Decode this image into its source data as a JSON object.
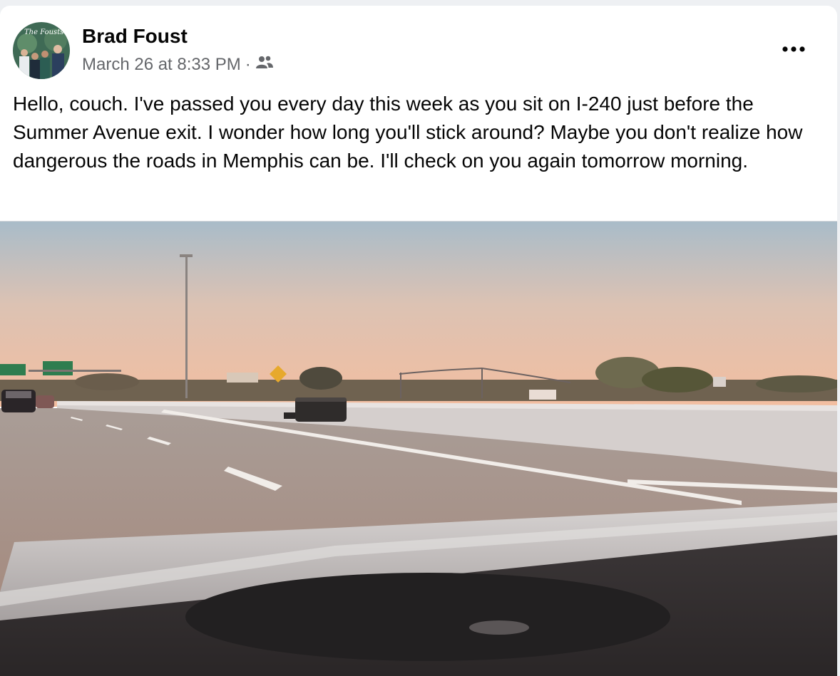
{
  "post": {
    "author": "Brad Foust",
    "timestamp": "March 26 at 8:33 PM",
    "separator": "·",
    "audience_icon": "friends-icon",
    "more_icon": "more-options-icon",
    "avatar_text": "The Fousts",
    "message": "Hello, couch. I've passed you every day this week as you sit on I-240 just before the Summer Avenue exit. I wonder how long you'll stick around? Maybe you don't realize how dangerous the roads in Memphis can be. I'll check on you again tomorrow morning."
  },
  "colors": {
    "name_text": "#050505",
    "meta_text": "#65676b",
    "sky_top": "#a7bbc8",
    "sky_bottom": "#f2c0a2",
    "road": "#a59289",
    "dashboard": "#2f2b2c"
  }
}
